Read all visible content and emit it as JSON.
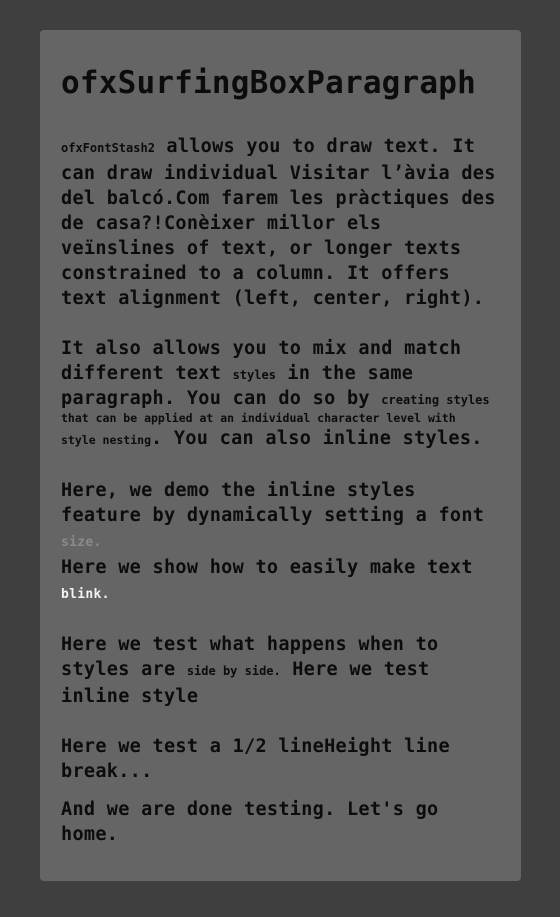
{
  "title": "ofxSurfingBoxParagraph",
  "p1": {
    "code": "ofxFontStash2",
    "line1": " allows you to draw text. It",
    "line2": "can draw individual Visitar l’àvia des",
    "line3": "del balcó.Com farem les pràctiques des",
    "line4": "de casa?!Conèixer millor els",
    "line5": "veïnslines of text, or longer texts",
    "line6": "constrained to a column. It offers",
    "line7": "text alignment (left, center, right)."
  },
  "p2": {
    "line1": "It also allows you to mix and match",
    "line2a": "different text ",
    "styles_word": "styles",
    "line2b": " in the same",
    "line3a": "paragraph. You can do so by ",
    "creating_styles": "creating styles",
    "small_line": "that can be applied at an individual character level with",
    "style_nesting": "style nesting",
    "line5b": ". You can also inline styles."
  },
  "p3": {
    "line1": "Here, we demo the inline styles",
    "line2": "feature by dynamically setting a font",
    "faded_size": "size.",
    "line3": "Here we show how to easily make text",
    "blink": "blink."
  },
  "p4": {
    "line1": "Here we test what happens when to",
    "line2a": "styles are ",
    "side_by_side": "side by side.",
    "line2b": " Here we test",
    "line3": "inline style"
  },
  "p5": {
    "line1": "Here we test a 1/2 lineHeight line",
    "line2": "break..."
  },
  "p6": {
    "line1": "And we are done testing. Let's go",
    "line2": "home."
  }
}
